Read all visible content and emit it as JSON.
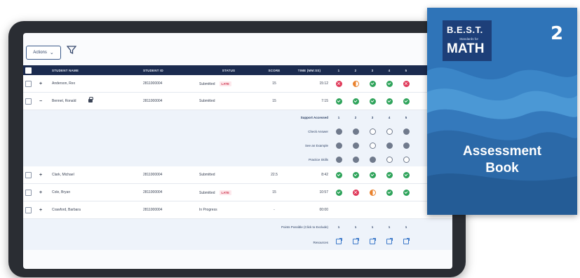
{
  "toolbar": {
    "actions_label": "Actions"
  },
  "table": {
    "headers": {
      "student_name": "STUDENT NAME",
      "student_id": "STUDENT ID",
      "status": "STATUS",
      "score": "SCORE",
      "time": "TIME (MM:SS)",
      "q": [
        "1",
        "2",
        "3",
        "4",
        "5"
      ]
    },
    "rows": [
      {
        "name": "Anderson, Rex",
        "id": "2811000004",
        "status": "Submitted",
        "late": "LATE",
        "score": "15",
        "time": "15:12",
        "results": [
          "incorrect",
          "partial",
          "correct",
          "correct",
          "incorrect"
        ]
      },
      {
        "name": "Bennet, Ronald",
        "id": "2811000004",
        "status": "Submitted",
        "late": "",
        "score": "15",
        "time": "7:15",
        "results": [
          "correct",
          "correct",
          "correct",
          "correct",
          "correct"
        ]
      },
      {
        "name": "Clark, Michael",
        "id": "2811000004",
        "status": "Submitted",
        "late": "",
        "score": "22.5",
        "time": "8:42",
        "results": [
          "correct",
          "correct",
          "correct",
          "correct",
          "correct"
        ]
      },
      {
        "name": "Cole, Bryan",
        "id": "2811000004",
        "status": "Submitted",
        "late": "LATE",
        "score": "15",
        "time": "10:57",
        "results": [
          "correct",
          "incorrect",
          "partial",
          "correct",
          "correct"
        ]
      },
      {
        "name": "Crawford, Barbara",
        "id": "2811000004",
        "status": "In Progress",
        "late": "",
        "score": "-",
        "time": "00:00",
        "results": []
      }
    ],
    "support": {
      "title": "Support Accessed",
      "cols": [
        "1",
        "2",
        "3",
        "4",
        "5"
      ],
      "items": [
        {
          "label": "Check Answer",
          "marks": [
            "filled",
            "filled",
            "empty",
            "empty",
            "filled"
          ]
        },
        {
          "label": "See an Example",
          "marks": [
            "filled",
            "filled",
            "empty",
            "filled",
            "filled"
          ]
        },
        {
          "label": "Practice Skills",
          "marks": [
            "filled",
            "filled",
            "filled",
            "empty",
            "empty"
          ]
        }
      ]
    },
    "footer": {
      "points_label": "Points Possible (Click to Exclude)",
      "points": [
        "1",
        "1",
        "1",
        "1",
        "1"
      ],
      "resources_label": "Resources"
    }
  },
  "book": {
    "badge_best": "B.E.S.T.",
    "badge_standards": "Standards for",
    "badge_math": "MATH",
    "grade": "2",
    "title_line1": "Assessment",
    "title_line2": "Book"
  }
}
